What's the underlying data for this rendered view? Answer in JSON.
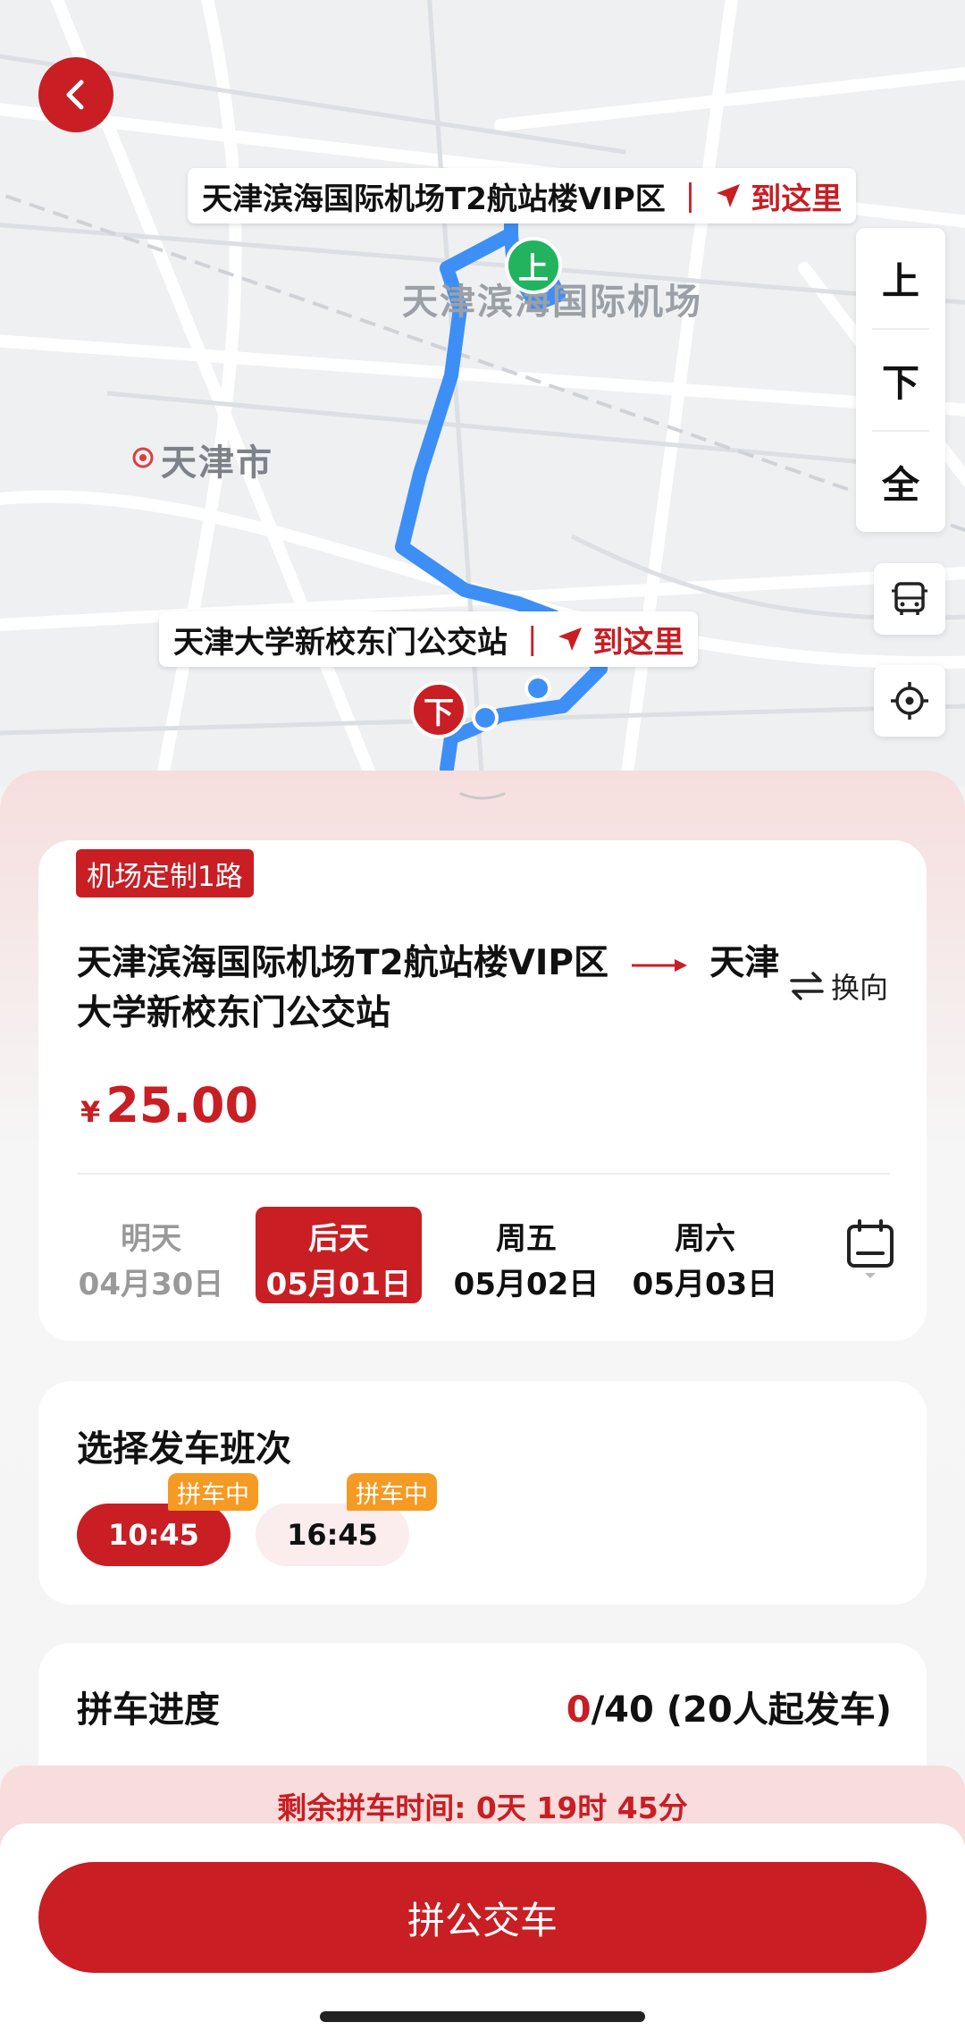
{
  "map": {
    "labels": {
      "airport": "天津滨海国际机场",
      "city": "天津市"
    },
    "start_callout": {
      "name": "天津滨海国际机场T2航站楼VIP区",
      "go": "到这里"
    },
    "end_callout": {
      "name": "天津大学新校东门公交站",
      "go": "到这里"
    },
    "start_pin": "上",
    "end_pin": "下",
    "side_tools": [
      "上",
      "下",
      "全"
    ]
  },
  "route": {
    "tag": "机场定制1路",
    "from": "天津滨海国际机场T2航站楼VIP区",
    "to": "天津大学新校东门公交站",
    "swap_label": "换向",
    "price_symbol": "¥",
    "price": "25.00"
  },
  "dates": [
    {
      "day": "明天",
      "date": "04月30日"
    },
    {
      "day": "后天",
      "date": "05月01日"
    },
    {
      "day": "周五",
      "date": "05月02日"
    },
    {
      "day": "周六",
      "date": "05月03日"
    }
  ],
  "schedule": {
    "title": "选择发车班次",
    "times": [
      {
        "time": "10:45",
        "badge": "拼车中"
      },
      {
        "time": "16:45",
        "badge": "拼车中"
      }
    ]
  },
  "progress": {
    "title": "拼车进度",
    "current": "0",
    "rest": "/40 (20人起发车)"
  },
  "remaining": "剩余拼车时间: 0天 19时 45分",
  "action_button": "拼公交车",
  "colors": {
    "accent": "#c81e24",
    "route": "#3d8ff5",
    "badge": "#f59a23",
    "start_pin": "#22b35e"
  }
}
